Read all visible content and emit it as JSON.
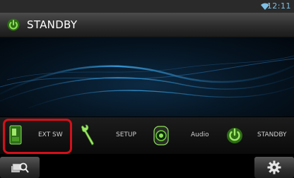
{
  "status_bar": {
    "time": "12:11",
    "wifi_icon": "wifi-icon"
  },
  "title_bar": {
    "icon": "power-icon",
    "title": "STANDBY"
  },
  "function_bar": {
    "buttons": [
      {
        "icon": "ext-switch-icon",
        "label": "EXT SW",
        "highlighted": true
      },
      {
        "icon": "wrench-icon",
        "label": "SETUP"
      },
      {
        "icon": "speaker-icon",
        "label": "Audio"
      },
      {
        "icon": "power-icon",
        "label": "STANDBY"
      }
    ],
    "highlight_color": "#d4101a"
  },
  "bottom_bar": {
    "left_icon": "source-search-icon",
    "right_icon": "gear-icon"
  },
  "colors": {
    "accent_green": "#5ec42a",
    "clock_blue": "#7fc0e6"
  }
}
